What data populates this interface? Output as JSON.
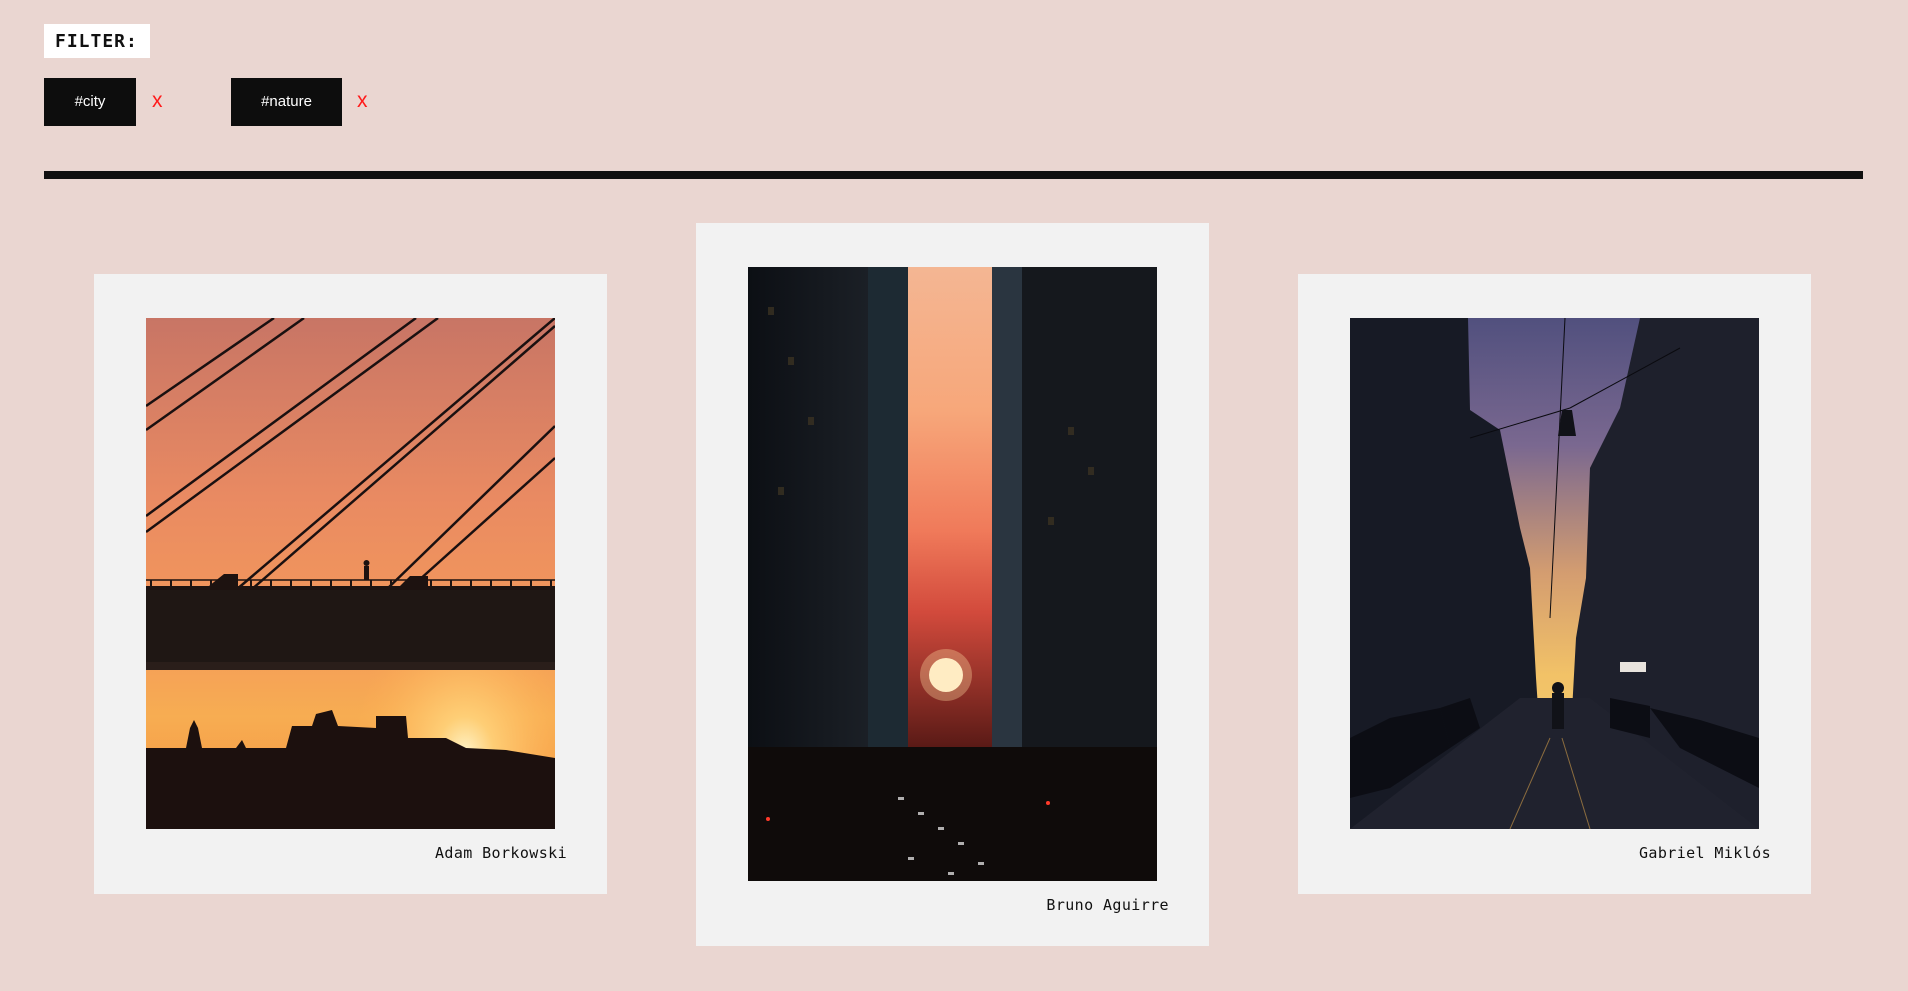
{
  "filter": {
    "label": "FILTER:",
    "tags": [
      {
        "label": "#city",
        "remove_label": "x"
      },
      {
        "label": "#nature",
        "remove_label": "x"
      }
    ]
  },
  "gallery": {
    "cards": [
      {
        "credit": "Adam Borkowski",
        "photo": "bridge-sunset-silhouette"
      },
      {
        "credit": "Bruno Aguirre",
        "photo": "city-canyon-sunset"
      },
      {
        "credit": "Gabriel Miklós",
        "photo": "street-evening-walker"
      }
    ]
  },
  "colors": {
    "background": "#ead6d1",
    "card": "#f2f2f2",
    "tag_background": "#0d0d0d",
    "remove_x": "#ff1a1a",
    "divider": "#111010"
  }
}
